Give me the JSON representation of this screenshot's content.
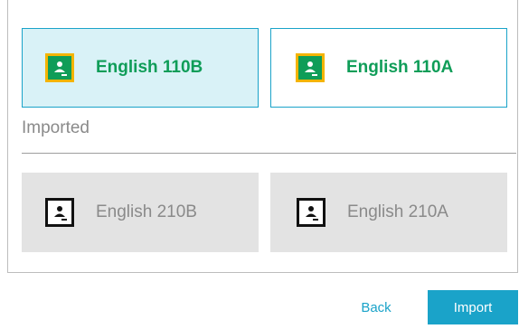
{
  "classes": [
    {
      "label": "English 110B",
      "state": "selected"
    },
    {
      "label": "English 110A",
      "state": "available"
    }
  ],
  "imported_section": {
    "title": "Imported",
    "classes": [
      {
        "label": "English 210B"
      },
      {
        "label": "English 210A"
      }
    ]
  },
  "icons": {
    "classroom": "google-classroom-icon",
    "imported": "classroom-bw-icon"
  },
  "colors": {
    "accent": "#1aa3c9",
    "selected_bg": "#d9f2f7",
    "classroom_green": "#0f9d58",
    "classroom_yellow": "#f4b400",
    "imported_bg": "#e3e3e3"
  },
  "actions": {
    "back_label": "Back",
    "import_label": "Import"
  }
}
